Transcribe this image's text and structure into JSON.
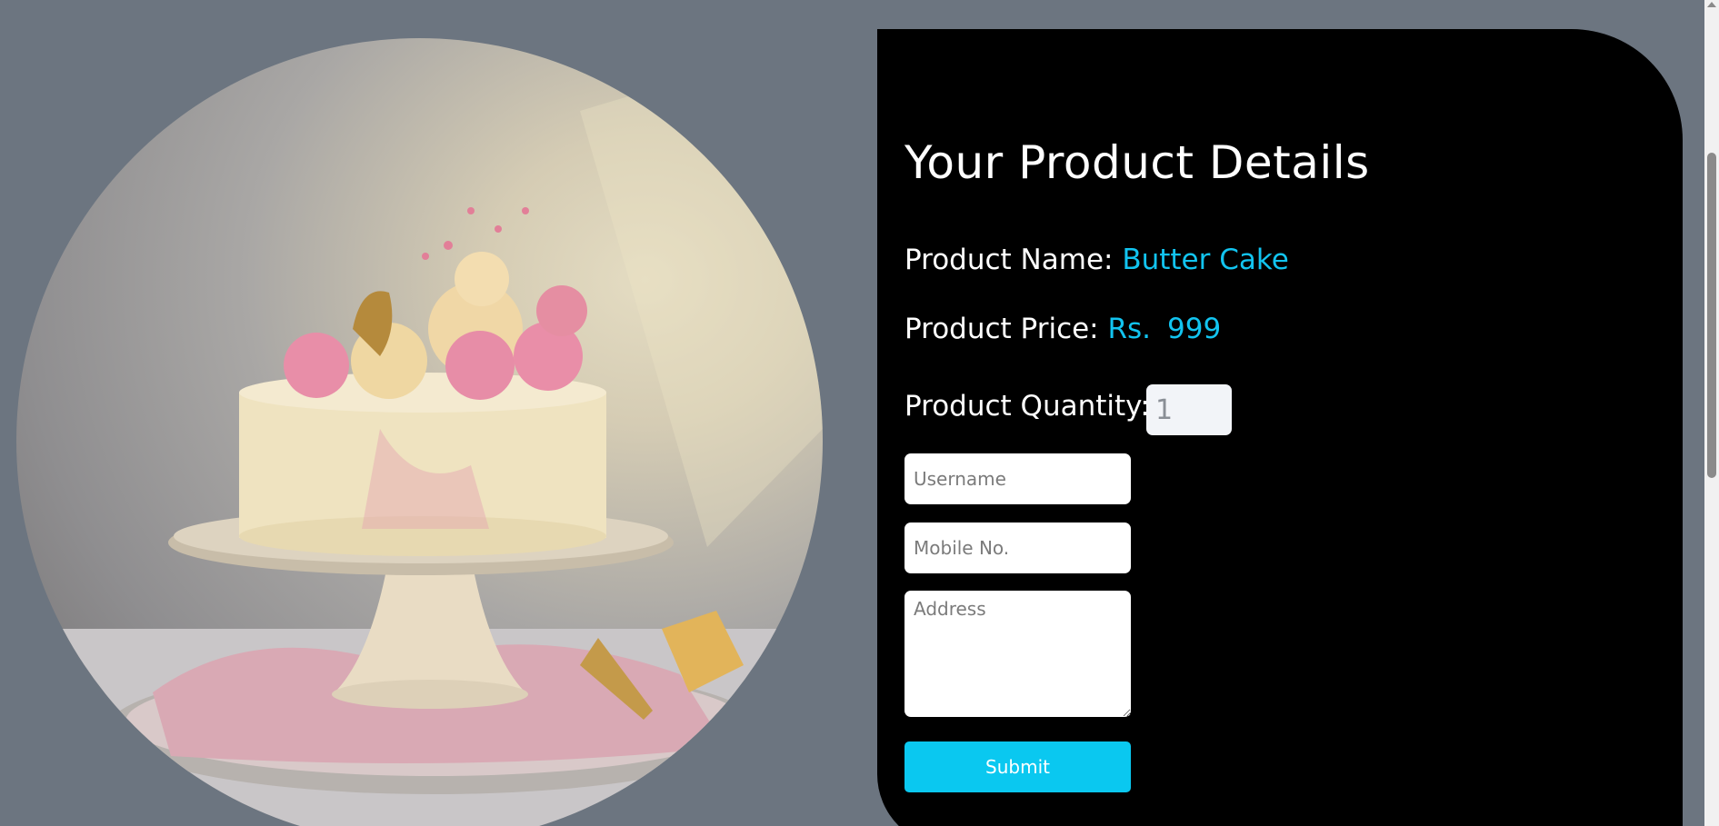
{
  "product": {
    "heading": "Your Product Details",
    "name_label": "Product Name:",
    "name_value": "Butter Cake",
    "price_label": "Product Price:",
    "price_currency": "Rs.",
    "price_value": "999",
    "quantity_label": "Product Quantity:",
    "quantity_value": "1"
  },
  "form": {
    "username_placeholder": "Username",
    "mobile_placeholder": "Mobile No.",
    "address_placeholder": "Address",
    "submit_label": "Submit"
  },
  "colors": {
    "page_background": "#6c7580",
    "panel_background": "#000000",
    "accent": "#0ac8f0",
    "value_text": "#12c4f0"
  },
  "image": {
    "subject": "cake-photo"
  }
}
